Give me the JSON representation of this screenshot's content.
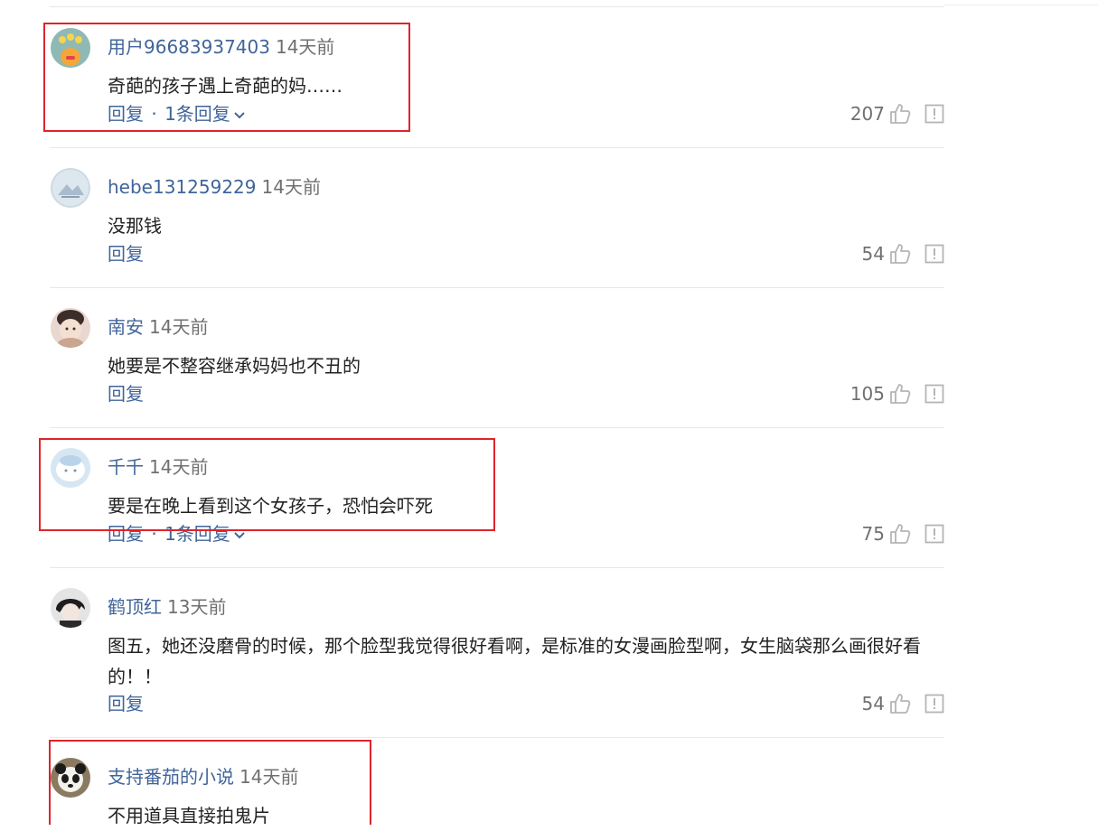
{
  "comments": [
    {
      "user": "用户96683937403",
      "time": "14天前",
      "text": "奇葩的孩子遇上奇葩的妈……",
      "reply": "回复",
      "dot": "·",
      "replies": "1条回复",
      "likes": "207",
      "avatar": "orange-cartoon-avatar"
    },
    {
      "user": "hebe131259229",
      "time": "14天前",
      "text": "没那钱",
      "reply": "回复",
      "likes": "54",
      "avatar": "pale-landscape-avatar"
    },
    {
      "user": "南安",
      "time": "14天前",
      "text": "她要是不整容继承妈妈也不丑的",
      "reply": "回复",
      "likes": "105",
      "avatar": "baby-photo-avatar"
    },
    {
      "user": "千千",
      "time": "14天前",
      "text": "要是在晚上看到这个女孩子，恐怕会吓死",
      "reply": "回复",
      "dot": "·",
      "replies": "1条回复",
      "likes": "75",
      "avatar": "light-blue-cartoon-avatar"
    },
    {
      "user": "鹤顶红",
      "time": "13天前",
      "text": "图五，她还没磨骨的时候，那个脸型我觉得很好看啊，是标准的女漫画脸型啊，女生脑袋那么画很好看的！！",
      "reply": "回复",
      "likes": "54",
      "avatar": "anime-boy-avatar"
    },
    {
      "user": "支持番茄的小说",
      "time": "14天前",
      "text": "不用道具直接拍鬼片",
      "avatar": "panda-avatar"
    }
  ],
  "colors": {
    "username": "#406599",
    "time": "#707070",
    "highlight_box": "#e0232b",
    "separator": "#e8e8e8"
  },
  "icons": {
    "like": "thumbs-up-icon",
    "report": "report-icon",
    "expand": "chevron-down-icon"
  }
}
